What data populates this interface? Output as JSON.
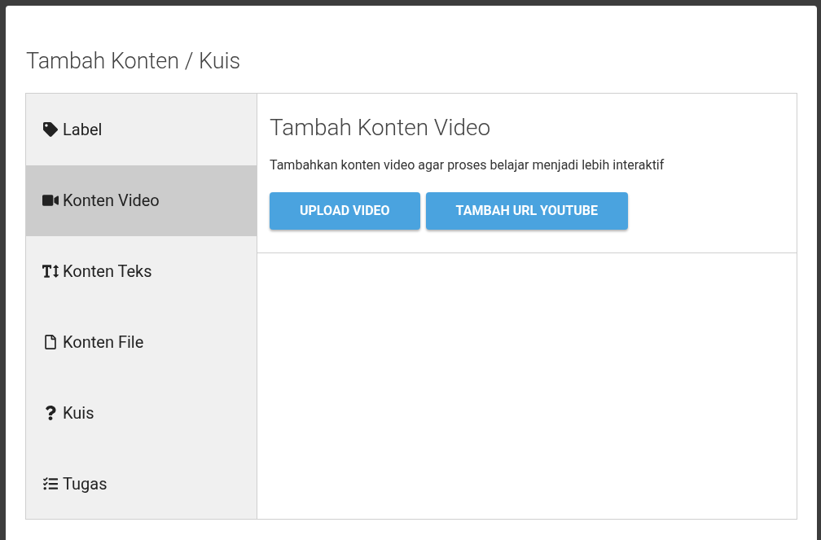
{
  "dialog": {
    "title": "Tambah Konten / Kuis"
  },
  "sidebar": {
    "items": [
      {
        "kind": "tag",
        "label": "Label",
        "selected": false
      },
      {
        "kind": "video",
        "label": "Konten Video",
        "selected": true
      },
      {
        "kind": "text",
        "label": "Konten Teks",
        "selected": false
      },
      {
        "kind": "file",
        "label": "Konten File",
        "selected": false
      },
      {
        "kind": "quiz",
        "label": "Kuis",
        "selected": false
      },
      {
        "kind": "task",
        "label": "Tugas",
        "selected": false
      }
    ]
  },
  "panel": {
    "title": "Tambah Konten Video",
    "description": "Tambahkan konten video agar proses belajar menjadi lebih interaktif",
    "buttons": [
      "UPLOAD VIDEO",
      "TAMBAH URL YOUTUBE"
    ]
  }
}
